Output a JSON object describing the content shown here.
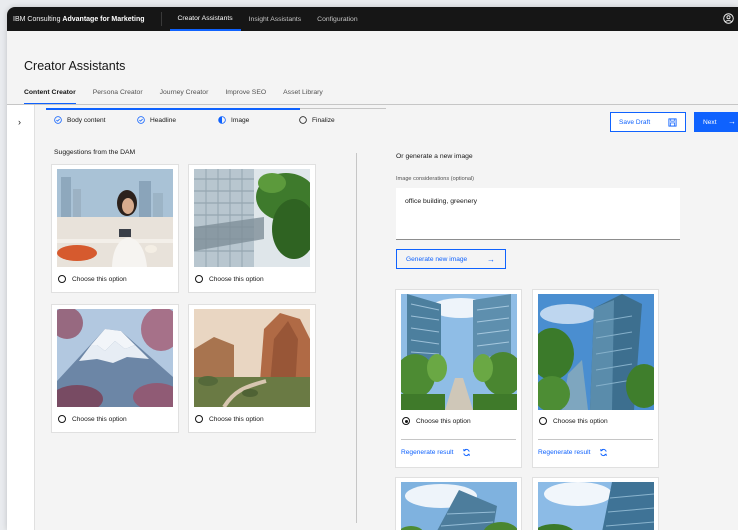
{
  "topbar": {
    "brand_prefix": "IBM Consulting",
    "brand_bold": "Advantage for Marketing",
    "nav": [
      {
        "label": "Creator Assistants",
        "active": true
      },
      {
        "label": "Insight Assistants",
        "active": false
      },
      {
        "label": "Configuration",
        "active": false
      }
    ],
    "user_icon": "user-avatar-icon"
  },
  "page": {
    "title": "Creator Assistants",
    "tabs": [
      {
        "label": "Content Creator",
        "active": true
      },
      {
        "label": "Persona Creator",
        "active": false
      },
      {
        "label": "Journey Creator",
        "active": false
      },
      {
        "label": "Improve SEO",
        "active": false
      },
      {
        "label": "Asset Library",
        "active": false
      }
    ]
  },
  "steps": [
    {
      "label": "Body content",
      "state": "complete"
    },
    {
      "label": "Headline",
      "state": "complete"
    },
    {
      "label": "Image",
      "state": "current"
    },
    {
      "label": "Finalize",
      "state": "incomplete"
    }
  ],
  "actions": {
    "save_draft": "Save Draft",
    "next": "Next",
    "next_icon": "→"
  },
  "dam": {
    "label": "Suggestions from the DAM",
    "options": [
      {
        "label": "Choose this option",
        "image": "woman-at-cafe-with-phone",
        "selected": false
      },
      {
        "label": "Choose this option",
        "image": "glass-skybridge-with-trees",
        "selected": false
      },
      {
        "label": "Choose this option",
        "image": "snow-mountain-with-blossoms",
        "selected": false
      },
      {
        "label": "Choose this option",
        "image": "red-rock-canyon-road",
        "selected": false
      }
    ]
  },
  "generate": {
    "label": "Or generate a new image",
    "field_label": "Image considerations (optional)",
    "field_value": "office building, greenery",
    "button": "Generate new image",
    "button_icon": "→",
    "results": [
      {
        "label": "Choose this option",
        "selected": true,
        "regen": "Regenerate result"
      },
      {
        "label": "Choose this option",
        "selected": false,
        "regen": "Regenerate result"
      }
    ]
  },
  "colors": {
    "accent": "#0f62fe",
    "topbar": "#161616",
    "background": "#f4f4f4"
  }
}
